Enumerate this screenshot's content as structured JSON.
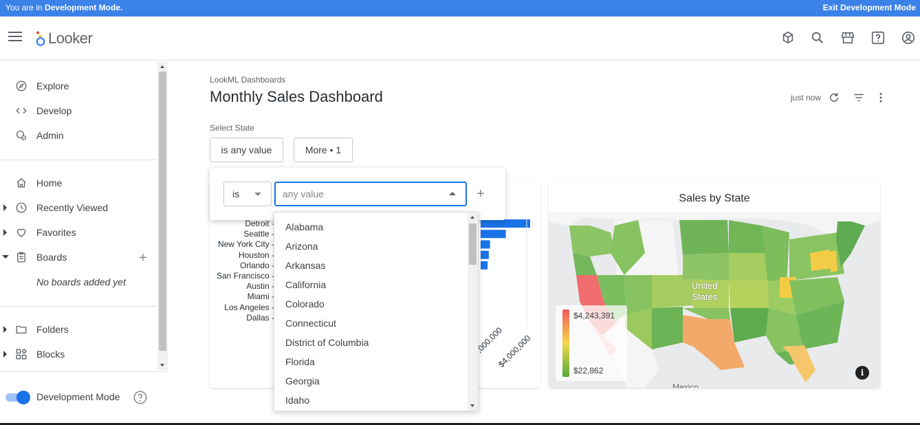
{
  "devbar": {
    "prefix": "You are in ",
    "mode": "Development Mode.",
    "exit": "Exit Development Mode"
  },
  "app": {
    "logo_text": "Looker",
    "top_icons": [
      "marketplace-icon",
      "search-icon",
      "store-icon",
      "help-icon",
      "account-icon"
    ]
  },
  "sidebar": {
    "items": [
      {
        "label": "Explore",
        "icon": "compass-icon"
      },
      {
        "label": "Develop",
        "icon": "code-icon"
      },
      {
        "label": "Admin",
        "icon": "admin-gear-icon"
      },
      {
        "label": "Home",
        "icon": "home-icon"
      },
      {
        "label": "Recently Viewed",
        "icon": "clock-icon"
      },
      {
        "label": "Favorites",
        "icon": "heart-icon"
      },
      {
        "label": "Boards",
        "icon": "board-icon"
      },
      {
        "label": "Folders",
        "icon": "folder-icon"
      },
      {
        "label": "Blocks",
        "icon": "blocks-icon"
      }
    ],
    "no_boards": "No boards added yet",
    "dev_mode_label": "Development Mode"
  },
  "dashboard": {
    "breadcrumb": "LookML Dashboards",
    "title": "Monthly Sales Dashboard",
    "updated": "just now",
    "filter_label": "Select State",
    "filter_value": "is any value",
    "more_button": "More • 1"
  },
  "filter_popover": {
    "operator": "is",
    "value_placeholder": "any value",
    "options": [
      "Alabama",
      "Arizona",
      "Arkansas",
      "California",
      "Colorado",
      "Connecticut",
      "District of Columbia",
      "Florida",
      "Georgia",
      "Idaho"
    ]
  },
  "bar_tile": {
    "cities": [
      "Detroit",
      "Seattle",
      "New York City",
      "Houston",
      "Orlando",
      "San Francisco",
      "Austin",
      "Miami",
      "Los Angeles",
      "Dallas"
    ],
    "tick_labels": [
      ",000,000",
      "$4,000,000"
    ]
  },
  "map_tile": {
    "title": "Sales by State",
    "legend_max": "$4,243,391",
    "legend_min": "$22,862",
    "country_label": "United States",
    "neighbor_label": "Mexico"
  },
  "chart_data": {
    "type": "bar",
    "title": "",
    "categories": [
      "Detroit",
      "Seattle",
      "New York City",
      "Houston",
      "Orlando"
    ],
    "values": [
      4300000,
      2300000,
      1000000,
      900000,
      800000
    ],
    "xlabel": "",
    "ylabel": ""
  }
}
